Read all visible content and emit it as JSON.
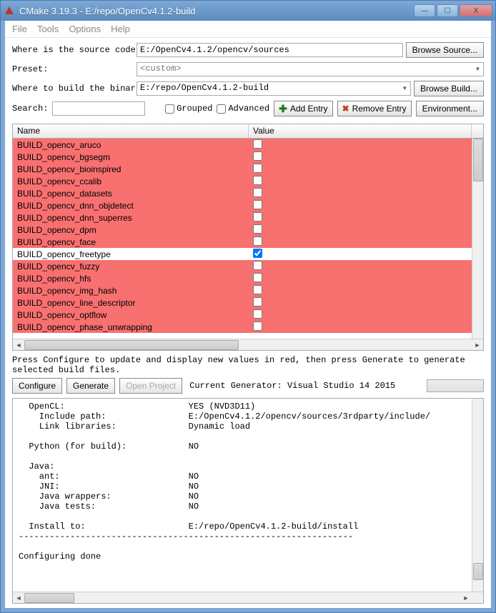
{
  "window": {
    "title": "CMake 3.19.3 - E:/repo/OpenCv4.1.2-build"
  },
  "menu": {
    "file": "File",
    "tools": "Tools",
    "options": "Options",
    "help": "Help"
  },
  "labels": {
    "source": "Where is the source code:",
    "preset": "Preset:",
    "binaries": "Where to build the binaries:",
    "search": "Search:"
  },
  "fields": {
    "source": "E:/OpenCv4.1.2/opencv/sources",
    "preset": "<custom>",
    "binaries": "E:/repo/OpenCv4.1.2-build"
  },
  "buttons": {
    "browse_source": "Browse Source...",
    "browse_build": "Browse Build...",
    "grouped": "Grouped",
    "advanced": "Advanced",
    "add_entry": "Add Entry",
    "remove_entry": "Remove Entry",
    "environment": "Environment...",
    "configure": "Configure",
    "generate": "Generate",
    "open_project": "Open Project"
  },
  "table": {
    "headers": {
      "name": "Name",
      "value": "Value"
    },
    "rows": [
      {
        "name": "BUILD_opencv_aruco",
        "checked": false,
        "sel": false
      },
      {
        "name": "BUILD_opencv_bgsegm",
        "checked": false,
        "sel": false
      },
      {
        "name": "BUILD_opencv_bioinspired",
        "checked": false,
        "sel": false
      },
      {
        "name": "BUILD_opencv_ccalib",
        "checked": false,
        "sel": false
      },
      {
        "name": "BUILD_opencv_datasets",
        "checked": false,
        "sel": false
      },
      {
        "name": "BUILD_opencv_dnn_objdetect",
        "checked": false,
        "sel": false
      },
      {
        "name": "BUILD_opencv_dnn_superres",
        "checked": false,
        "sel": false
      },
      {
        "name": "BUILD_opencv_dpm",
        "checked": false,
        "sel": false
      },
      {
        "name": "BUILD_opencv_face",
        "checked": false,
        "sel": false
      },
      {
        "name": "BUILD_opencv_freetype",
        "checked": true,
        "sel": true
      },
      {
        "name": "BUILD_opencv_fuzzy",
        "checked": false,
        "sel": false
      },
      {
        "name": "BUILD_opencv_hfs",
        "checked": false,
        "sel": false
      },
      {
        "name": "BUILD_opencv_img_hash",
        "checked": false,
        "sel": false
      },
      {
        "name": "BUILD_opencv_line_descriptor",
        "checked": false,
        "sel": false
      },
      {
        "name": "BUILD_opencv_optflow",
        "checked": false,
        "sel": false
      },
      {
        "name": "BUILD_opencv_phase_unwrapping",
        "checked": false,
        "sel": false
      }
    ]
  },
  "hint": "Press Configure to update and display new values in red,  then press Generate to generate selected build files.",
  "generator_note": "Current Generator: Visual Studio 14 2015",
  "output": "  OpenCL:                        YES (NVD3D11)\n    Include path:                E:/OpenCv4.1.2/opencv/sources/3rdparty/include/\n    Link libraries:              Dynamic load\n\n  Python (for build):            NO\n\n  Java:\n    ant:                         NO\n    JNI:                         NO\n    Java wrappers:               NO\n    Java tests:                  NO\n\n  Install to:                    E:/repo/OpenCv4.1.2-build/install\n-----------------------------------------------------------------\n\nConfiguring done"
}
